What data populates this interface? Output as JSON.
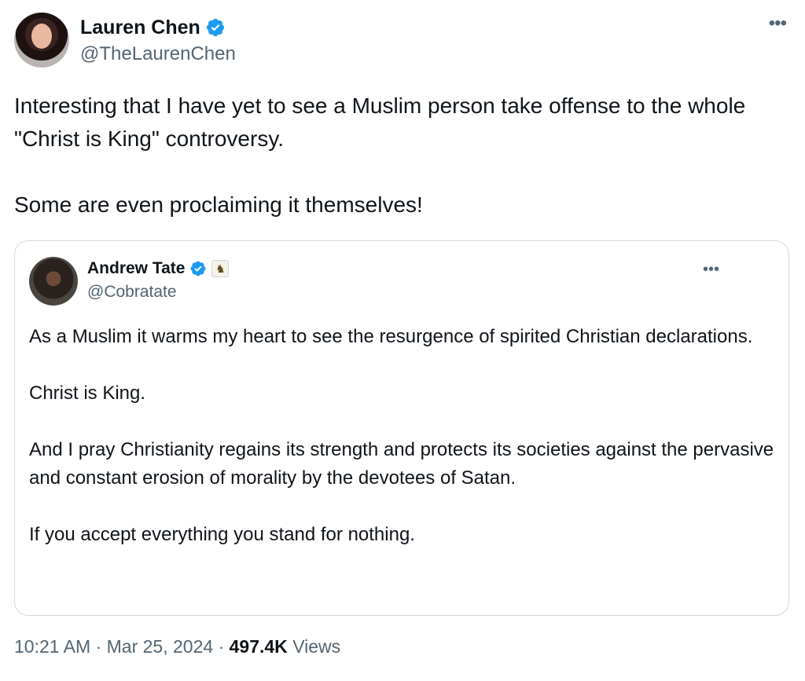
{
  "author": {
    "display_name": "Lauren Chen",
    "handle": "@TheLaurenChen",
    "verified": true
  },
  "tweet_text": "Interesting that I have yet to see a Muslim person take offense to the whole \"Christ is King\" controversy.\n\nSome are even proclaiming it themselves!",
  "quoted_tweet": {
    "display_name": "Andrew Tate",
    "handle": "@Cobratate",
    "verified": true,
    "affiliate_badge": "♞",
    "text": "As a Muslim it warms my heart to see the resurgence of spirited Christian declarations.\n\nChrist is King.\n\nAnd I pray Christianity regains its strength and protects its societies against the pervasive and constant erosion of morality by the devotees of Satan.\n\nIf you accept everything you stand for nothing."
  },
  "meta": {
    "time": "10:21 AM",
    "separator": "·",
    "date": "Mar 25, 2024",
    "views_count": "497.4K",
    "views_label": "Views"
  },
  "icons": {
    "more": "more-icon",
    "verified": "verified-icon"
  },
  "colors": {
    "verified_blue": "#1d9bf0",
    "secondary_text": "#536471",
    "border": "#cfd9de"
  }
}
